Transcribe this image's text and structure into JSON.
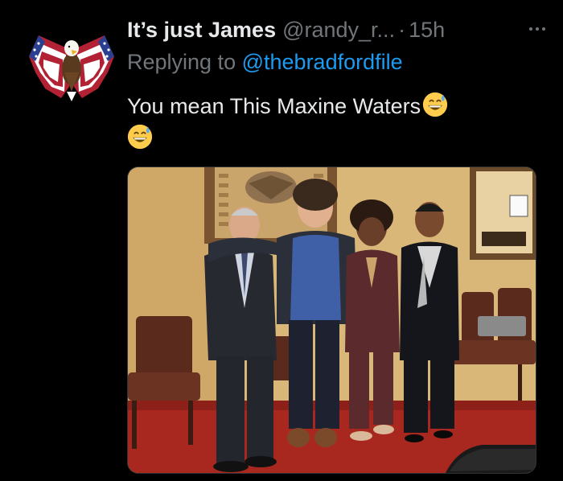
{
  "tweet": {
    "display_name": "It’s just James",
    "handle": "@randy_r...",
    "separator": "·",
    "timestamp": "15h",
    "replying_prefix": "Replying to",
    "replying_to": "@thebradfordfile",
    "text": "You mean This Maxine Waters",
    "emojis": [
      "grinning-face-with-sweat",
      "grinning-face-with-sweat"
    ]
  },
  "colors": {
    "background": "#000000",
    "primary_text": "#e7e9ea",
    "secondary_text": "#71767b",
    "link": "#1d9bf0",
    "emoji_yellow": "#ffcc4d",
    "sweat_blue": "#5dadec"
  },
  "avatar": {
    "icon": "bald-eagle-american-flag-wings"
  },
  "media": {
    "type": "photo",
    "scene": "four people posing in an office room"
  },
  "more_icon": "ellipsis-icon"
}
